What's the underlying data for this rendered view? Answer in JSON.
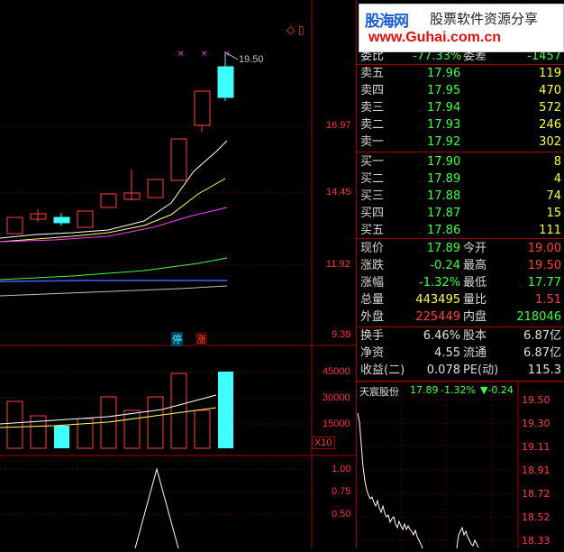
{
  "chart": {
    "price_high_label": "19.50",
    "price_axis": [
      "16.97",
      "14.45",
      "11.92",
      "9.39"
    ],
    "volume_axis": [
      "45000",
      "30000",
      "15000"
    ],
    "volume_unit": "X10",
    "indicator_axis": [
      "1.00",
      "0.75",
      "0.50"
    ],
    "badge_stop": "停",
    "badge_limit": "涨",
    "corner_icons": "◇ ▯"
  },
  "banner": {
    "logo": "股海网",
    "slogan": "股票软件资源分享",
    "url": "www.Guhai.com.cn"
  },
  "orderbook": {
    "top_partial": [
      {
        "label": "委比",
        "value": "-77.33%"
      },
      {
        "label": "委差",
        "value": "-1457"
      }
    ],
    "sell": [
      {
        "label": "卖五",
        "price": "17.96",
        "qty": "119"
      },
      {
        "label": "卖四",
        "price": "17.95",
        "qty": "470"
      },
      {
        "label": "卖三",
        "price": "17.94",
        "qty": "572"
      },
      {
        "label": "卖二",
        "price": "17.93",
        "qty": "246"
      },
      {
        "label": "卖一",
        "price": "17.92",
        "qty": "302"
      }
    ],
    "buy": [
      {
        "label": "买一",
        "price": "17.90",
        "qty": "8"
      },
      {
        "label": "买二",
        "price": "17.89",
        "qty": "4"
      },
      {
        "label": "买三",
        "price": "17.88",
        "qty": "74"
      },
      {
        "label": "买四",
        "price": "17.87",
        "qty": "15"
      },
      {
        "label": "买五",
        "price": "17.86",
        "qty": "111"
      }
    ]
  },
  "quote": {
    "rows": [
      {
        "l1": "现价",
        "v1": "17.89",
        "c1": "grn",
        "l2": "今开",
        "v2": "19.00",
        "c2": "red"
      },
      {
        "l1": "涨跌",
        "v1": "-0.24",
        "c1": "grn",
        "l2": "最高",
        "v2": "19.50",
        "c2": "red"
      },
      {
        "l1": "涨幅",
        "v1": "-1.32%",
        "c1": "grn",
        "l2": "最低",
        "v2": "17.77",
        "c2": "grn"
      },
      {
        "l1": "总量",
        "v1": "443495",
        "c1": "yel",
        "l2": "量比",
        "v2": "1.51",
        "c2": "red"
      },
      {
        "l1": "外盘",
        "v1": "225449",
        "c1": "red",
        "l2": "内盘",
        "v2": "218046",
        "c2": "grn"
      }
    ],
    "fund_rows": [
      {
        "l1": "换手",
        "v1": "6.46%",
        "l2": "股本",
        "v2": "6.87亿"
      },
      {
        "l1": "净资",
        "v1": "4.55",
        "l2": "流通",
        "v2": "6.87亿"
      },
      {
        "l1": "收益(二)",
        "v1": "0.078",
        "l2": "PE(动)",
        "v2": "115.3"
      }
    ]
  },
  "mini": {
    "name": "天宸股份",
    "price": "17.89",
    "change_pct": "-1.32%",
    "change": "▼-0.24",
    "axis": [
      "19.50",
      "19.30",
      "19.11",
      "18.91",
      "18.72",
      "18.52",
      "18.33"
    ]
  },
  "colors": {
    "up": "#ff4040",
    "down": "#40ff40",
    "grid": "#a00000",
    "vol_cyan": "#40ffff"
  }
}
